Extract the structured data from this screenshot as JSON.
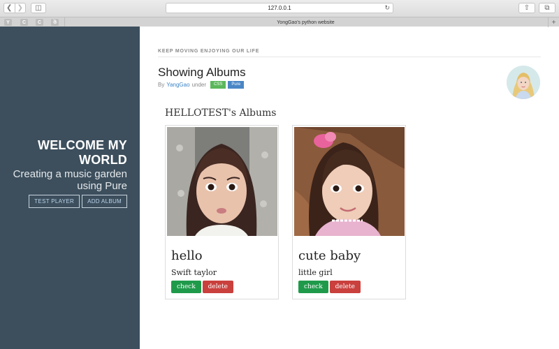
{
  "browser": {
    "url": "127.0.0.1",
    "tab_title": "YongGao's python website",
    "favicons": [
      "Y",
      "C",
      "C",
      "☃"
    ]
  },
  "sidebar": {
    "title": "WELCOME MY WORLD",
    "tagline": "Creating a music garden using Pure",
    "buttons": {
      "test_player": "TEST PLAYER",
      "add_album": "ADD ALBUM"
    }
  },
  "main": {
    "motto": "KEEP MOVING ENJOYING OUR LIFE",
    "title": "Showing Albums",
    "byline": {
      "by": "By",
      "author": "YangGao",
      "under": "under"
    },
    "tags": [
      {
        "label": "CSS",
        "color": "#5bb75b"
      },
      {
        "label": "Pure",
        "color": "#4a86c5"
      }
    ],
    "section_title": "HELLOTEST's Albums",
    "albums": [
      {
        "title": "hello",
        "artist": "Swift taylor",
        "check": "check",
        "delete": "delete"
      },
      {
        "title": "cute baby",
        "artist": "little girl",
        "check": "check",
        "delete": "delete"
      }
    ]
  },
  "colors": {
    "sidebar_bg": "#3d4f5d",
    "check": "#1f9a4a",
    "delete": "#c9403d",
    "link": "#3b83c6"
  }
}
